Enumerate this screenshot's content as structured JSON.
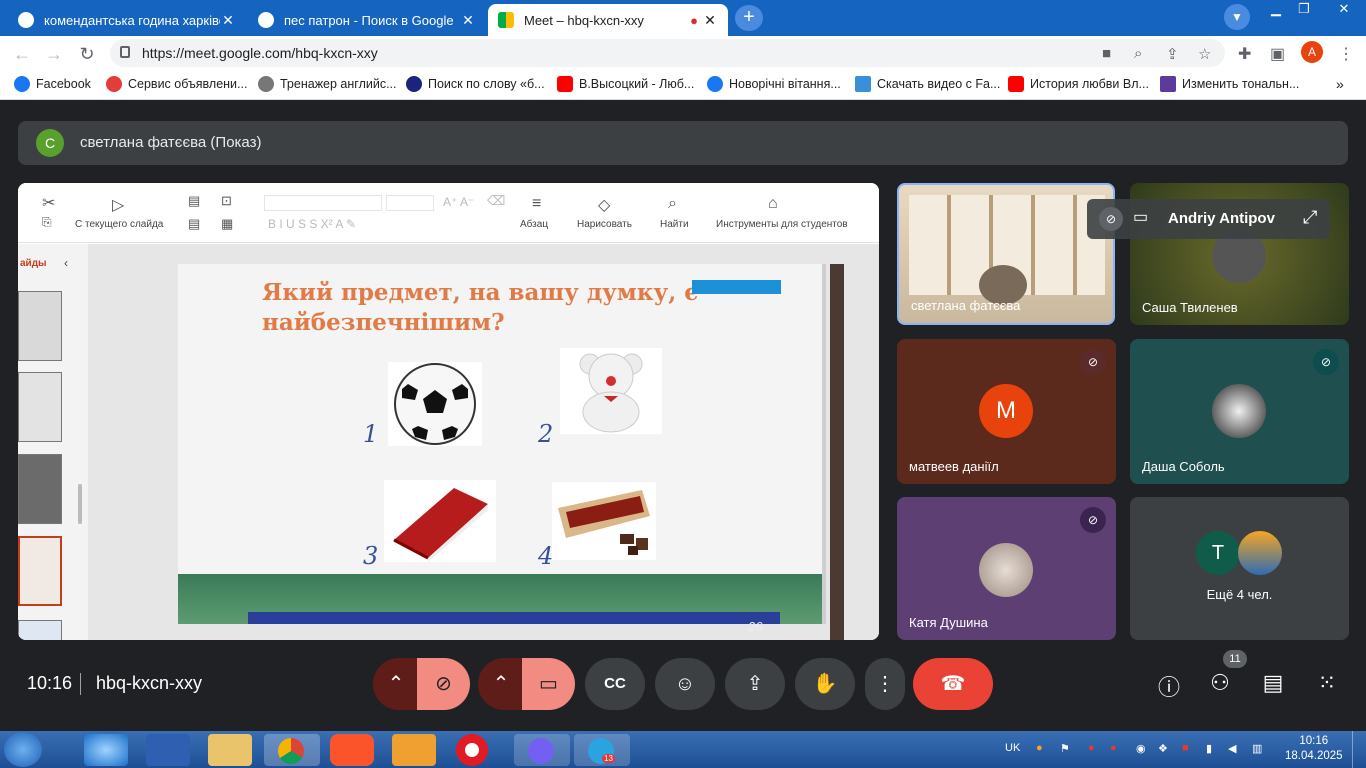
{
  "tabs": [
    {
      "title": "комендантська година харківсь",
      "active": false
    },
    {
      "title": "пес патрон - Поиск в Google",
      "active": false
    },
    {
      "title": "Meet – hbq-kxcn-xxy",
      "active": true
    }
  ],
  "address_bar": {
    "url": "https://meet.google.com/hbq-kxcn-xxy"
  },
  "profile_initial": "A",
  "bookmarks": [
    {
      "label": "Facebook",
      "color": "#1877f2"
    },
    {
      "label": "Сервис объявлени...",
      "color": "#e43b3b"
    },
    {
      "label": "Тренажер английс...",
      "color": "#777777"
    },
    {
      "label": "Поиск по слову «б...",
      "color": "#1a237e"
    },
    {
      "label": "В.Высоцкий - Люб...",
      "color": "#ff0000"
    },
    {
      "label": "Новорічні вітання...",
      "color": "#1877f2"
    },
    {
      "label": "Скачать видео с Fa...",
      "color": "#3b8fd9"
    },
    {
      "label": "История любви Вл...",
      "color": "#ff0000"
    },
    {
      "label": "Изменить тональн...",
      "color": "#5c3b9a"
    }
  ],
  "presenter": {
    "initial": "С",
    "label": "светлана фатєєва (Показ)"
  },
  "ribbon": {
    "from_slide": "С текущего слайда",
    "paragraph": "Абзац",
    "draw": "Нарисовать",
    "find": "Найти",
    "students": "Инструменты для студентов",
    "slides_tab": "айды"
  },
  "slide": {
    "title": "Який предмет, на вашу думку, є найбезпечнішим?",
    "numbers": [
      "1",
      "2",
      "3",
      "4"
    ],
    "page_number": "26"
  },
  "participants": [
    {
      "name": "светлана фатєєва",
      "type": "video"
    },
    {
      "name": "Саша Твиленев",
      "type": "video"
    },
    {
      "name": "матвеев даніїл",
      "initial": "М",
      "muted": true
    },
    {
      "name": "Даша Соболь",
      "type": "avatar",
      "muted": true
    },
    {
      "name": "Катя Душина",
      "type": "avatar",
      "muted": true
    },
    {
      "name": "Ещё 4 чел.",
      "initial": "Т",
      "type": "more"
    }
  ],
  "pinned_overlay": {
    "name": "Andriy Antipov"
  },
  "controls": {
    "time": "10:16",
    "meeting_code": "hbq-kxcn-xxy",
    "participant_count": "11"
  },
  "taskbar": {
    "language": "UK",
    "time": "10:16",
    "date": "18.04.2025",
    "telegram_badge": "13"
  }
}
